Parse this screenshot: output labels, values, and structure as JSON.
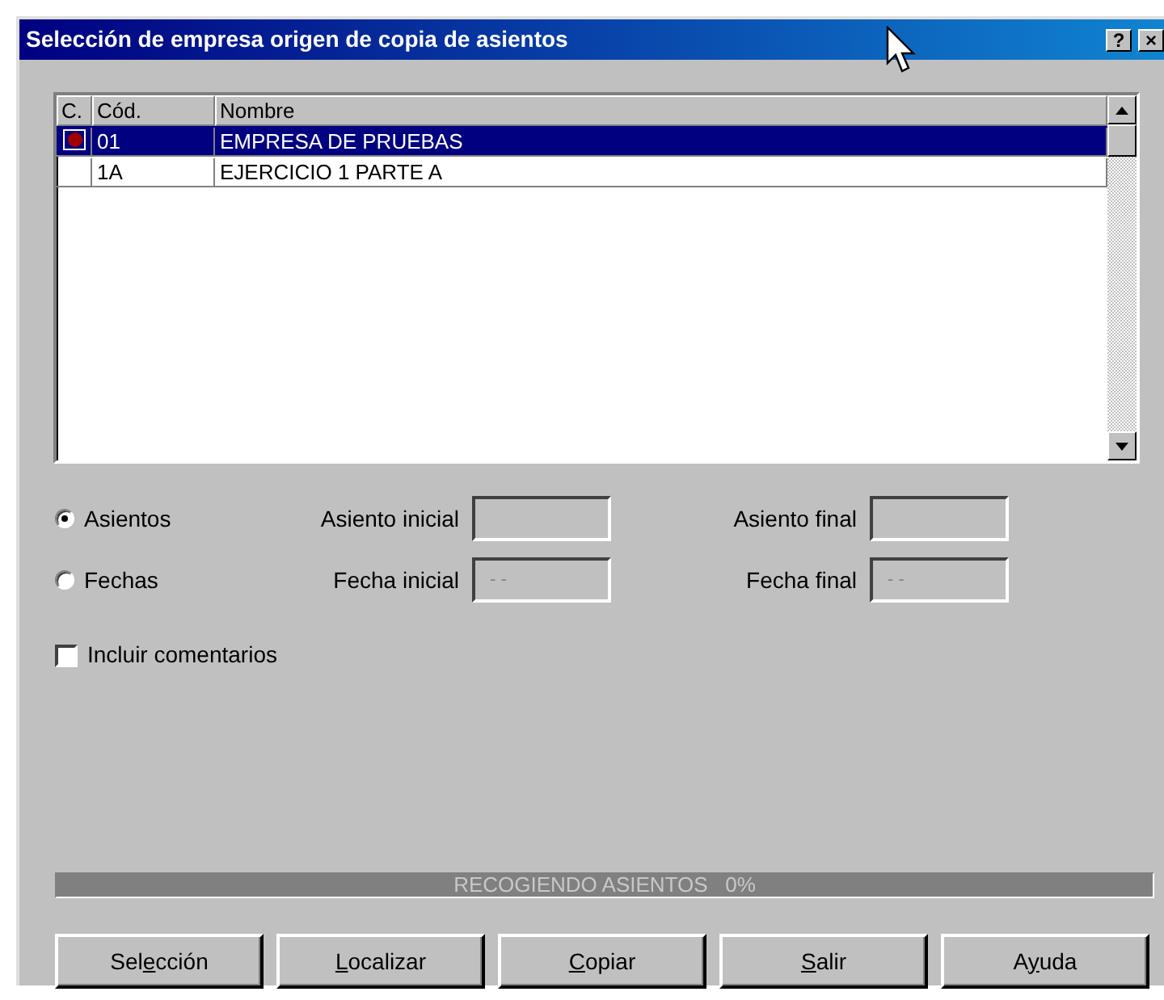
{
  "window": {
    "title": "Selección de empresa origen de copia de asientos",
    "help": "?",
    "close": "×"
  },
  "table": {
    "columns": [
      "C.",
      "Cód.",
      "Nombre"
    ],
    "rows": [
      {
        "checked": true,
        "selected": true,
        "code": "01",
        "name": "EMPRESA DE PRUEBAS"
      },
      {
        "checked": false,
        "selected": false,
        "code": "1A",
        "name": "EJERCICIO 1 PARTE A"
      }
    ]
  },
  "mode": [
    {
      "label": "Asientos",
      "selected": true,
      "from_label": "Asiento inicial",
      "to_label": "Asiento final"
    },
    {
      "label": "Fechas",
      "selected": false,
      "from_label": "Fecha inicial",
      "from_value": " - -",
      "to_label": "Fecha final",
      "to_value": " - -"
    }
  ],
  "include_comments": {
    "label": "Incluir comentarios",
    "checked": false
  },
  "progress": {
    "text": "RECOGIENDO ASIENTOS   0%",
    "level": 0
  },
  "buttons": [
    {
      "before": "Sel",
      "key": "e",
      "after": "cción"
    },
    {
      "key": "L",
      "after": "ocalizar"
    },
    {
      "key": "C",
      "after": "opiar"
    },
    {
      "key": "S",
      "after": "alir"
    },
    {
      "before": "A",
      "key": "y",
      "after": "uda"
    }
  ]
}
